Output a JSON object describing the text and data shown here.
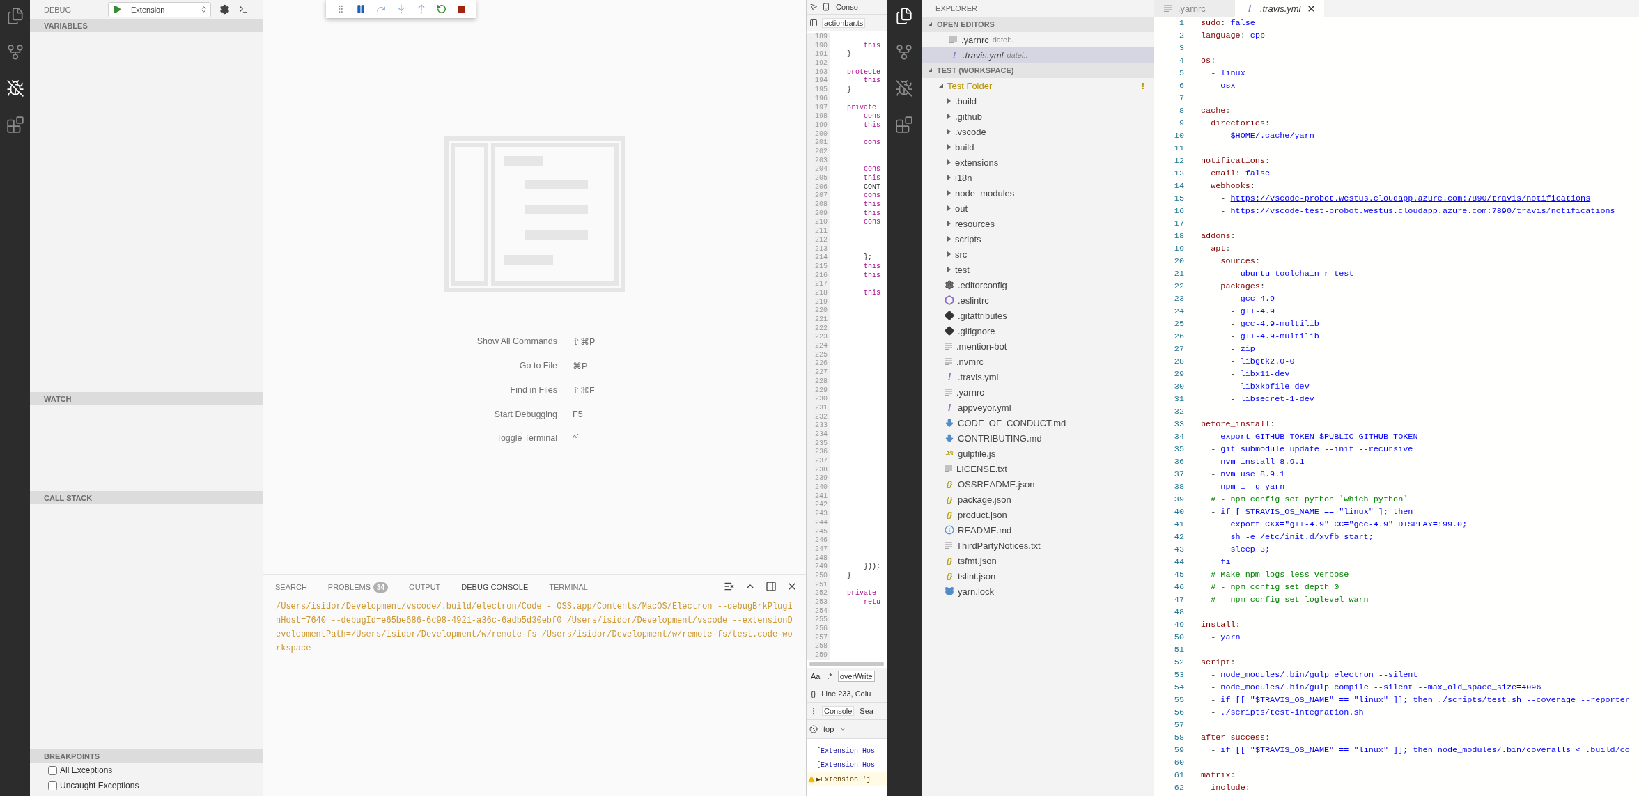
{
  "left_activity_bar": [
    {
      "kind": "files",
      "selected": false
    },
    {
      "kind": "source-control",
      "selected": false
    },
    {
      "kind": "debug",
      "selected": true
    },
    {
      "kind": "extensions",
      "selected": false
    }
  ],
  "debug_sidebar": {
    "title": "DEBUG",
    "configuration": "Extension",
    "sections": [
      {
        "title": "VARIABLES"
      },
      {
        "title": "WATCH"
      },
      {
        "title": "CALL STACK"
      },
      {
        "title": "BREAKPOINTS",
        "items": [
          {
            "label": "All Exceptions",
            "checked": false
          },
          {
            "label": "Uncaught Exceptions",
            "checked": false
          }
        ]
      }
    ]
  },
  "welcome": {
    "shortcuts": [
      {
        "label": "Show All Commands",
        "keys": "⇧⌘P"
      },
      {
        "label": "Go to File",
        "keys": "⌘P"
      },
      {
        "label": "Find in Files",
        "keys": "⇧⌘F"
      },
      {
        "label": "Start Debugging",
        "keys": "F5"
      },
      {
        "label": "Toggle Terminal",
        "keys": "^`"
      }
    ]
  },
  "panel": {
    "tabs": [
      {
        "label": "SEARCH",
        "selected": false
      },
      {
        "label": "PROBLEMS",
        "badge": "34",
        "selected": false
      },
      {
        "label": "OUTPUT",
        "selected": false
      },
      {
        "label": "DEBUG CONSOLE",
        "selected": true
      },
      {
        "label": "TERMINAL",
        "selected": false
      }
    ],
    "output": "/Users/isidor/Development/vscode/.build/electron/Code - OSS.app/Contents/MacOS/Electron --debugBrkPluginHost=7640 --debugId=e65be686-6c98-4921-a36c-6adb5d30ebf0 /Users/isidor/Development/vscode --extensionDevelopmentPath=/Users/isidor/Development/w/remote-fs /Users/isidor/Development/w/remote-fs/test.code-workspace"
  },
  "devtools": {
    "panel_tab": "Conso",
    "file_tab": "actionbar.ts",
    "lines": [
      {
        "number": "189"
      },
      {
        "number": "190",
        "kind": "keyword",
        "text": "        this"
      },
      {
        "number": "191",
        "kind": "plain",
        "text": "    }"
      },
      {
        "number": "192"
      },
      {
        "number": "193",
        "kind": "keyword",
        "text": "    protecte"
      },
      {
        "number": "194",
        "kind": "keyword",
        "text": "        this"
      },
      {
        "number": "195",
        "kind": "plain",
        "text": "    }"
      },
      {
        "number": "196"
      },
      {
        "number": "197",
        "kind": "keyword",
        "text": "    private"
      },
      {
        "number": "198",
        "kind": "keyword",
        "text": "        cons"
      },
      {
        "number": "199",
        "kind": "keyword",
        "text": "        this"
      },
      {
        "number": "200"
      },
      {
        "number": "201",
        "kind": "keyword",
        "text": "        cons"
      },
      {
        "number": "202"
      },
      {
        "number": "203"
      },
      {
        "number": "204",
        "kind": "keyword",
        "text": "        cons"
      },
      {
        "number": "205",
        "kind": "keyword",
        "text": "        this"
      },
      {
        "number": "206",
        "kind": "plain",
        "text": "        CONT"
      },
      {
        "number": "207",
        "kind": "keyword",
        "text": "        cons"
      },
      {
        "number": "208",
        "kind": "keyword",
        "text": "        this"
      },
      {
        "number": "209",
        "kind": "keyword",
        "text": "        this"
      },
      {
        "number": "210",
        "kind": "keyword",
        "text": "        cons"
      },
      {
        "number": "211"
      },
      {
        "number": "212"
      },
      {
        "number": "213"
      },
      {
        "number": "214",
        "kind": "plain",
        "text": "        };"
      },
      {
        "number": "215",
        "kind": "keyword",
        "text": "        this"
      },
      {
        "number": "216",
        "kind": "keyword",
        "text": "        this"
      },
      {
        "number": "217"
      },
      {
        "number": "218",
        "kind": "keyword",
        "text": "        this"
      },
      {
        "number": "219"
      },
      {
        "number": "220"
      },
      {
        "number": "221"
      },
      {
        "number": "222"
      },
      {
        "number": "223"
      },
      {
        "number": "224"
      },
      {
        "number": "225"
      },
      {
        "number": "226"
      },
      {
        "number": "227"
      },
      {
        "number": "228"
      },
      {
        "number": "229"
      },
      {
        "number": "230"
      },
      {
        "number": "231"
      },
      {
        "number": "232"
      },
      {
        "number": "233"
      },
      {
        "number": "234"
      },
      {
        "number": "235"
      },
      {
        "number": "236"
      },
      {
        "number": "237"
      },
      {
        "number": "238"
      },
      {
        "number": "239"
      },
      {
        "number": "240"
      },
      {
        "number": "241"
      },
      {
        "number": "242"
      },
      {
        "number": "243"
      },
      {
        "number": "244"
      },
      {
        "number": "245"
      },
      {
        "number": "246"
      },
      {
        "number": "247"
      },
      {
        "number": "248"
      },
      {
        "number": "249",
        "kind": "plain",
        "text": "        }));"
      },
      {
        "number": "250",
        "kind": "plain",
        "text": "    }"
      },
      {
        "number": "251"
      },
      {
        "number": "252",
        "kind": "keyword",
        "text": "    private"
      },
      {
        "number": "253",
        "kind": "keyword",
        "text": "        retu"
      },
      {
        "number": "254"
      },
      {
        "number": "255"
      },
      {
        "number": "256"
      },
      {
        "number": "257"
      },
      {
        "number": "258"
      },
      {
        "number": "259"
      }
    ],
    "search": {
      "case_toggle": "Aa",
      "regex_toggle": ".*",
      "value": "overWrite"
    },
    "format_button": "{}",
    "status": "Line 233, Colu",
    "console_tabs": [
      {
        "label": "Console",
        "selected": true
      },
      {
        "label": "Sea",
        "selected": false
      }
    ],
    "context": "top",
    "messages": [
      {
        "kind": "log",
        "text": "[Extension Hos"
      },
      {
        "kind": "log",
        "text": "[Extension Hos"
      },
      {
        "kind": "warning",
        "text": "▶Extension 'j"
      }
    ]
  },
  "right_activity_bar": [
    {
      "kind": "files",
      "selected": true
    },
    {
      "kind": "source-control",
      "selected": false
    },
    {
      "kind": "debug",
      "selected": false
    },
    {
      "kind": "extensions",
      "selected": false
    }
  ],
  "explorer": {
    "title": "EXPLORER",
    "open_editors": {
      "title": "OPEN EDITORS",
      "expanded": true,
      "items": [
        {
          "name": ".yarnrc",
          "description": "datei:.",
          "kind": "text",
          "preview": false,
          "selected": false
        },
        {
          "name": ".travis.yml",
          "description": "datei:.",
          "kind": "yaml",
          "glyph": "!",
          "preview": true,
          "selected": true
        }
      ]
    },
    "workspace": {
      "title": "TEST (WORKSPACE)",
      "expanded": true,
      "tree": [
        {
          "name": "Test Folder",
          "kind": "folder",
          "expanded": true,
          "decoration": "!",
          "children": [
            {
              "name": ".build",
              "kind": "folder",
              "expanded": false
            },
            {
              "name": ".github",
              "kind": "folder",
              "expanded": false
            },
            {
              "name": ".vscode",
              "kind": "folder",
              "expanded": false
            },
            {
              "name": "build",
              "kind": "folder",
              "expanded": false
            },
            {
              "name": "extensions",
              "kind": "folder",
              "expanded": false
            },
            {
              "name": "i18n",
              "kind": "folder",
              "expanded": false
            },
            {
              "name": "node_modules",
              "kind": "folder",
              "expanded": false
            },
            {
              "name": "out",
              "kind": "folder",
              "expanded": false
            },
            {
              "name": "resources",
              "kind": "folder",
              "expanded": false
            },
            {
              "name": "scripts",
              "kind": "folder",
              "expanded": false
            },
            {
              "name": "src",
              "kind": "folder",
              "expanded": false
            },
            {
              "name": "test",
              "kind": "folder",
              "expanded": false
            },
            {
              "name": ".editorconfig",
              "kind": "settings"
            },
            {
              "name": ".eslintrc",
              "kind": "eslint"
            },
            {
              "name": ".gitattributes",
              "kind": "git"
            },
            {
              "name": ".gitignore",
              "kind": "git"
            },
            {
              "name": ".mention-bot",
              "kind": "text"
            },
            {
              "name": ".nvmrc",
              "kind": "text"
            },
            {
              "name": ".travis.yml",
              "kind": "yaml",
              "glyph": "!"
            },
            {
              "name": ".yarnrc",
              "kind": "text"
            },
            {
              "name": "appveyor.yml",
              "kind": "yaml",
              "glyph": "!"
            },
            {
              "name": "CODE_OF_CONDUCT.md",
              "kind": "markdown"
            },
            {
              "name": "CONTRIBUTING.md",
              "kind": "markdown"
            },
            {
              "name": "gulpfile.js",
              "kind": "js",
              "glyph": "JS"
            },
            {
              "name": "LICENSE.txt",
              "kind": "text"
            },
            {
              "name": "OSSREADME.json",
              "kind": "json",
              "glyph": "{}"
            },
            {
              "name": "package.json",
              "kind": "json",
              "glyph": "{}"
            },
            {
              "name": "product.json",
              "kind": "json",
              "glyph": "{}"
            },
            {
              "name": "README.md",
              "kind": "info"
            },
            {
              "name": "ThirdPartyNotices.txt",
              "kind": "text"
            },
            {
              "name": "tsfmt.json",
              "kind": "json",
              "glyph": "{}"
            },
            {
              "name": "tslint.json",
              "kind": "json",
              "glyph": "{}"
            },
            {
              "name": "yarn.lock",
              "kind": "yarn"
            }
          ]
        }
      ]
    }
  },
  "editor": {
    "tabs": [
      {
        "name": ".yarnrc",
        "kind": "text",
        "preview": false,
        "selected": false
      },
      {
        "name": ".travis.yml",
        "kind": "yaml",
        "glyph": "!",
        "preview": true,
        "selected": true
      }
    ],
    "lines": [
      {
        "number": "1",
        "tokens": [
          {
            "kind": "key",
            "text": "sudo"
          },
          {
            "kind": "punct",
            "text": ": "
          },
          {
            "kind": "value",
            "text": "false"
          }
        ]
      },
      {
        "number": "2",
        "tokens": [
          {
            "kind": "key",
            "text": "language"
          },
          {
            "kind": "punct",
            "text": ": "
          },
          {
            "kind": "value",
            "text": "cpp"
          }
        ]
      },
      {
        "number": "3"
      },
      {
        "number": "4",
        "tokens": [
          {
            "kind": "key",
            "text": "os"
          },
          {
            "kind": "punct",
            "text": ":"
          }
        ]
      },
      {
        "number": "5",
        "tokens": [
          {
            "kind": "punct",
            "text": "  - "
          },
          {
            "kind": "value",
            "text": "linux"
          }
        ]
      },
      {
        "number": "6",
        "tokens": [
          {
            "kind": "punct",
            "text": "  - "
          },
          {
            "kind": "value",
            "text": "osx"
          }
        ]
      },
      {
        "number": "7"
      },
      {
        "number": "8",
        "tokens": [
          {
            "kind": "key",
            "text": "cache"
          },
          {
            "kind": "punct",
            "text": ":"
          }
        ]
      },
      {
        "number": "9",
        "tokens": [
          {
            "kind": "key",
            "text": "  directories"
          },
          {
            "kind": "punct",
            "text": ":"
          }
        ]
      },
      {
        "number": "10",
        "tokens": [
          {
            "kind": "punct",
            "text": "    - "
          },
          {
            "kind": "value",
            "text": "$HOME/.cache/yarn"
          }
        ]
      },
      {
        "number": "11"
      },
      {
        "number": "12",
        "tokens": [
          {
            "kind": "key",
            "text": "notifications"
          },
          {
            "kind": "punct",
            "text": ":"
          }
        ]
      },
      {
        "number": "13",
        "tokens": [
          {
            "kind": "key",
            "text": "  email"
          },
          {
            "kind": "punct",
            "text": ": "
          },
          {
            "kind": "value",
            "text": "false"
          }
        ]
      },
      {
        "number": "14",
        "tokens": [
          {
            "kind": "key",
            "text": "  webhooks"
          },
          {
            "kind": "punct",
            "text": ":"
          }
        ]
      },
      {
        "number": "15",
        "tokens": [
          {
            "kind": "punct",
            "text": "    - "
          },
          {
            "kind": "link",
            "text": "https://vscode-probot.westus.cloudapp.azure.com:7890/travis/notifications"
          }
        ]
      },
      {
        "number": "16",
        "tokens": [
          {
            "kind": "punct",
            "text": "    - "
          },
          {
            "kind": "link",
            "text": "https://vscode-test-probot.westus.cloudapp.azure.com:7890/travis/notifications"
          }
        ]
      },
      {
        "number": "17"
      },
      {
        "number": "18",
        "tokens": [
          {
            "kind": "key",
            "text": "addons"
          },
          {
            "kind": "punct",
            "text": ":"
          }
        ]
      },
      {
        "number": "19",
        "tokens": [
          {
            "kind": "key",
            "text": "  apt"
          },
          {
            "kind": "punct",
            "text": ":"
          }
        ]
      },
      {
        "number": "20",
        "tokens": [
          {
            "kind": "key",
            "text": "    sources"
          },
          {
            "kind": "punct",
            "text": ":"
          }
        ]
      },
      {
        "number": "21",
        "tokens": [
          {
            "kind": "punct",
            "text": "      - "
          },
          {
            "kind": "value",
            "text": "ubuntu-toolchain-r-test"
          }
        ]
      },
      {
        "number": "22",
        "tokens": [
          {
            "kind": "key",
            "text": "    packages"
          },
          {
            "kind": "punct",
            "text": ":"
          }
        ]
      },
      {
        "number": "23",
        "tokens": [
          {
            "kind": "punct",
            "text": "      - "
          },
          {
            "kind": "value",
            "text": "gcc-4.9"
          }
        ]
      },
      {
        "number": "24",
        "tokens": [
          {
            "kind": "punct",
            "text": "      - "
          },
          {
            "kind": "value",
            "text": "g++-4.9"
          }
        ]
      },
      {
        "number": "25",
        "tokens": [
          {
            "kind": "punct",
            "text": "      - "
          },
          {
            "kind": "value",
            "text": "gcc-4.9-multilib"
          }
        ]
      },
      {
        "number": "26",
        "tokens": [
          {
            "kind": "punct",
            "text": "      - "
          },
          {
            "kind": "value",
            "text": "g++-4.9-multilib"
          }
        ]
      },
      {
        "number": "27",
        "tokens": [
          {
            "kind": "punct",
            "text": "      - "
          },
          {
            "kind": "value",
            "text": "zip"
          }
        ]
      },
      {
        "number": "28",
        "tokens": [
          {
            "kind": "punct",
            "text": "      - "
          },
          {
            "kind": "value",
            "text": "libgtk2.0-0"
          }
        ]
      },
      {
        "number": "29",
        "tokens": [
          {
            "kind": "punct",
            "text": "      - "
          },
          {
            "kind": "value",
            "text": "libx11-dev"
          }
        ]
      },
      {
        "number": "30",
        "tokens": [
          {
            "kind": "punct",
            "text": "      - "
          },
          {
            "kind": "value",
            "text": "libxkbfile-dev"
          }
        ]
      },
      {
        "number": "31",
        "tokens": [
          {
            "kind": "punct",
            "text": "      - "
          },
          {
            "kind": "value",
            "text": "libsecret-1-dev"
          }
        ]
      },
      {
        "number": "32"
      },
      {
        "number": "33",
        "tokens": [
          {
            "kind": "key",
            "text": "before_install"
          },
          {
            "kind": "punct",
            "text": ":"
          }
        ]
      },
      {
        "number": "34",
        "tokens": [
          {
            "kind": "punct",
            "text": "  - "
          },
          {
            "kind": "value",
            "text": "export GITHUB_TOKEN=$PUBLIC_GITHUB_TOKEN"
          }
        ]
      },
      {
        "number": "35",
        "tokens": [
          {
            "kind": "punct",
            "text": "  - "
          },
          {
            "kind": "value",
            "text": "git submodule update --init --recursive"
          }
        ]
      },
      {
        "number": "36",
        "tokens": [
          {
            "kind": "punct",
            "text": "  - "
          },
          {
            "kind": "value",
            "text": "nvm install 8.9.1"
          }
        ]
      },
      {
        "number": "37",
        "tokens": [
          {
            "kind": "punct",
            "text": "  - "
          },
          {
            "kind": "value",
            "text": "nvm use 8.9.1"
          }
        ]
      },
      {
        "number": "38",
        "tokens": [
          {
            "kind": "punct",
            "text": "  - "
          },
          {
            "kind": "value",
            "text": "npm i -g yarn"
          }
        ]
      },
      {
        "number": "39",
        "tokens": [
          {
            "kind": "comment",
            "text": "  # - npm config set python `which python`"
          }
        ]
      },
      {
        "number": "40",
        "tokens": [
          {
            "kind": "punct",
            "text": "  - "
          },
          {
            "kind": "value",
            "text": "if [ $TRAVIS_OS_NAME == \"linux\" ]; then"
          }
        ]
      },
      {
        "number": "41",
        "tokens": [
          {
            "kind": "value",
            "text": "      export CXX=\"g++-4.9\" CC=\"gcc-4.9\" DISPLAY=:99.0;"
          }
        ]
      },
      {
        "number": "42",
        "tokens": [
          {
            "kind": "value",
            "text": "      sh -e /etc/init.d/xvfb start;"
          }
        ]
      },
      {
        "number": "43",
        "tokens": [
          {
            "kind": "value",
            "text": "      sleep 3;"
          }
        ]
      },
      {
        "number": "44",
        "tokens": [
          {
            "kind": "value",
            "text": "    fi"
          }
        ]
      },
      {
        "number": "45",
        "tokens": [
          {
            "kind": "comment",
            "text": "  # Make npm logs less verbose"
          }
        ]
      },
      {
        "number": "46",
        "tokens": [
          {
            "kind": "comment",
            "text": "  # - npm config set depth 0"
          }
        ]
      },
      {
        "number": "47",
        "tokens": [
          {
            "kind": "comment",
            "text": "  # - npm config set loglevel warn"
          }
        ]
      },
      {
        "number": "48"
      },
      {
        "number": "49",
        "tokens": [
          {
            "kind": "key",
            "text": "install"
          },
          {
            "kind": "punct",
            "text": ":"
          }
        ]
      },
      {
        "number": "50",
        "tokens": [
          {
            "kind": "punct",
            "text": "  - "
          },
          {
            "kind": "value",
            "text": "yarn"
          }
        ]
      },
      {
        "number": "51"
      },
      {
        "number": "52",
        "tokens": [
          {
            "kind": "key",
            "text": "script"
          },
          {
            "kind": "punct",
            "text": ":"
          }
        ]
      },
      {
        "number": "53",
        "tokens": [
          {
            "kind": "punct",
            "text": "  - "
          },
          {
            "kind": "value",
            "text": "node_modules/.bin/gulp electron --silent"
          }
        ]
      },
      {
        "number": "54",
        "tokens": [
          {
            "kind": "punct",
            "text": "  - "
          },
          {
            "kind": "value",
            "text": "node_modules/.bin/gulp compile --silent --max_old_space_size=4096"
          }
        ]
      },
      {
        "number": "55",
        "tokens": [
          {
            "kind": "punct",
            "text": "  - "
          },
          {
            "kind": "value",
            "text": "if [[ \"$TRAVIS_OS_NAME\" == \"linux\" ]]; then ./scripts/test.sh --coverage --reporter"
          }
        ]
      },
      {
        "number": "56",
        "tokens": [
          {
            "kind": "punct",
            "text": "  - "
          },
          {
            "kind": "value",
            "text": "./scripts/test-integration.sh"
          }
        ]
      },
      {
        "number": "57"
      },
      {
        "number": "58",
        "tokens": [
          {
            "kind": "key",
            "text": "after_success"
          },
          {
            "kind": "punct",
            "text": ":"
          }
        ]
      },
      {
        "number": "59",
        "tokens": [
          {
            "kind": "punct",
            "text": "  - "
          },
          {
            "kind": "value",
            "text": "if [[ \"$TRAVIS_OS_NAME\" == \"linux\" ]]; then node_modules/.bin/coveralls < .build/co"
          }
        ]
      },
      {
        "number": "60"
      },
      {
        "number": "61",
        "tokens": [
          {
            "kind": "key",
            "text": "matrix"
          },
          {
            "kind": "punct",
            "text": ":"
          }
        ]
      },
      {
        "number": "62",
        "tokens": [
          {
            "kind": "key",
            "text": "  include"
          },
          {
            "kind": "punct",
            "text": ":"
          }
        ]
      }
    ]
  }
}
